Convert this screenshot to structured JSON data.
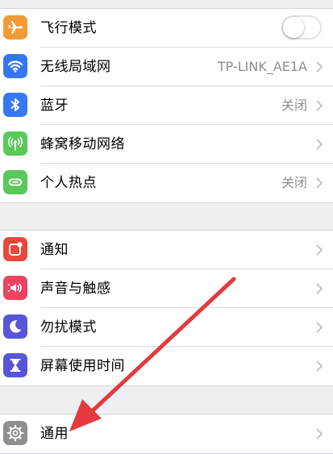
{
  "colors": {
    "airplane": "#f19a37",
    "wifi": "#3478f6",
    "bluetooth": "#3478f6",
    "cellular": "#5bc85a",
    "hotspot": "#5bc85a",
    "notifications": "#e9483b",
    "sounds": "#ea4461",
    "dnd": "#5856d6",
    "screentime": "#5856d6",
    "general": "#8e8e93",
    "annotation_arrow": "#e33a3f"
  },
  "group1": {
    "items": [
      {
        "icon": "airplane-icon",
        "label": "飞行模式",
        "control": "toggle",
        "toggle_on": false
      },
      {
        "icon": "wifi-icon",
        "label": "无线局域网",
        "value": "TP-LINK_AE1A"
      },
      {
        "icon": "bluetooth-icon",
        "label": "蓝牙",
        "value": "关闭"
      },
      {
        "icon": "cellular-icon",
        "label": "蜂窝移动网络",
        "value": ""
      },
      {
        "icon": "hotspot-icon",
        "label": "个人热点",
        "value": "关闭"
      }
    ]
  },
  "group2": {
    "items": [
      {
        "icon": "notifications-icon",
        "label": "通知"
      },
      {
        "icon": "speaker-icon",
        "label": "声音与触感"
      },
      {
        "icon": "moon-icon",
        "label": "勿扰模式"
      },
      {
        "icon": "hourglass-icon",
        "label": "屏幕使用时间"
      }
    ]
  },
  "group3": {
    "items": [
      {
        "icon": "gear-icon",
        "label": "通用"
      }
    ]
  }
}
